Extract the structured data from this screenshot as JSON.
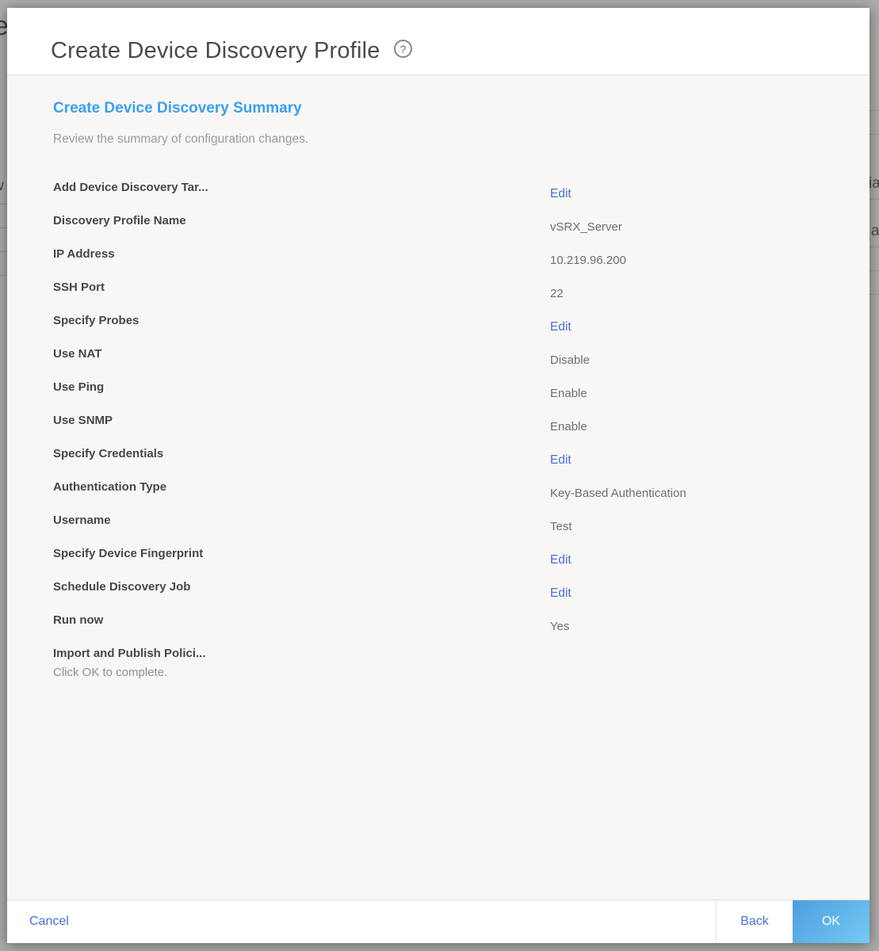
{
  "colors": {
    "accent_blue": "#3aa0f0",
    "link_blue": "#4a6fd6",
    "ok_gradient_start": "#4d9de0",
    "ok_gradient_end": "#74cbf2"
  },
  "backdrop_fragments": {
    "left_top": "e",
    "left_mid": "w",
    "right_top": "ia",
    "right_mid": "a"
  },
  "modal": {
    "title": "Create Device Discovery Profile",
    "help_icon": "?",
    "heading": "Create Device Discovery Summary",
    "subtitle": "Review the summary of configuration changes.",
    "sections": [
      {
        "title": "Add Device Discovery Tar...",
        "action": "Edit",
        "rows": [
          {
            "label": "Discovery Profile Name",
            "value": "vSRX_Server"
          },
          {
            "label": "IP Address",
            "value": "10.219.96.200"
          },
          {
            "label": "SSH Port",
            "value": "22"
          }
        ]
      },
      {
        "title": "Specify Probes",
        "action": "Edit",
        "rows": [
          {
            "label": "Use NAT",
            "value": "Disable"
          },
          {
            "label": "Use Ping",
            "value": "Enable"
          },
          {
            "label": "Use SNMP",
            "value": "Enable"
          }
        ]
      },
      {
        "title": "Specify Credentials",
        "action": "Edit",
        "rows": [
          {
            "label": "Authentication Type",
            "value": "Key-Based Authentication"
          },
          {
            "label": "Username",
            "value": "Test"
          }
        ]
      },
      {
        "title": "Specify Device Fingerprint",
        "action": "Edit",
        "rows": []
      },
      {
        "title": "Schedule Discovery Job",
        "action": "Edit",
        "rows": [
          {
            "label": "Run now",
            "value": "Yes"
          }
        ]
      },
      {
        "title": "Import and Publish Polici...",
        "action": "",
        "note": "Click OK to complete.",
        "rows": []
      }
    ],
    "footer": {
      "cancel": "Cancel",
      "back": "Back",
      "ok": "OK"
    }
  }
}
